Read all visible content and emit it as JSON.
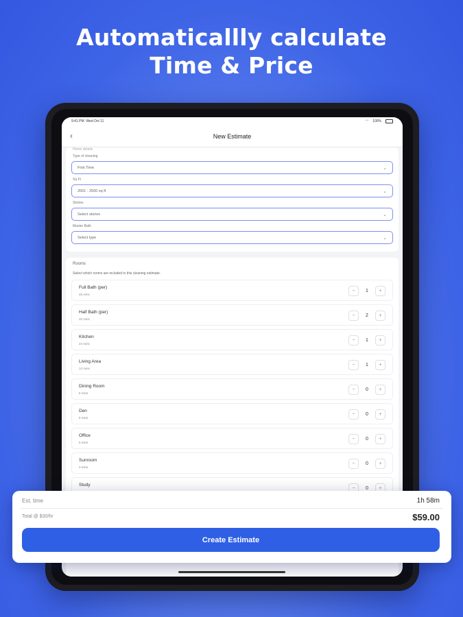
{
  "headline": {
    "line1": "Automaticallly calculate",
    "line2": "Time & Price"
  },
  "status": {
    "time": "9:41 PM",
    "date": "Wed Oct 11",
    "right": "100%"
  },
  "nav": {
    "back": "‹",
    "title": "New Estimate"
  },
  "form": {
    "section_label": "Home details",
    "cleaning_type": {
      "label": "Type of cleaning",
      "value": "First Time"
    },
    "sqft": {
      "label": "Sq Ft",
      "value": "2001 - 2500 sq ft"
    },
    "stories": {
      "label": "Stories",
      "placeholder": "Select stories"
    },
    "master_bath": {
      "label": "Master Bath",
      "placeholder": "Select type"
    }
  },
  "rooms": {
    "title": "Rooms",
    "description": "Select which rooms are included in this cleaning estimate.",
    "items": [
      {
        "name": "Full Bath (per)",
        "time": "45 mins",
        "count": "1"
      },
      {
        "name": "Half Bath (per)",
        "time": "20 mins",
        "count": "2"
      },
      {
        "name": "Kitchen",
        "time": "24 mins",
        "count": "1"
      },
      {
        "name": "Living Area",
        "time": "12 mins",
        "count": "1"
      },
      {
        "name": "Dining Room",
        "time": "6 mins",
        "count": "0"
      },
      {
        "name": "Den",
        "time": "8 mins",
        "count": "0"
      },
      {
        "name": "Office",
        "time": "5 mins",
        "count": "0"
      },
      {
        "name": "Sunroom",
        "time": "3 mins",
        "count": "0"
      },
      {
        "name": "Study",
        "time": "",
        "count": "0"
      }
    ],
    "minus": "−",
    "plus": "+"
  },
  "summary": {
    "est_label": "Est. time",
    "est_value": "1h 58m",
    "total_label": "Total @ $30/hr",
    "total_value": "$59.00",
    "button": "Create Estimate"
  },
  "colors": {
    "accent": "#2f5fe4",
    "background": "#3d63e6"
  }
}
